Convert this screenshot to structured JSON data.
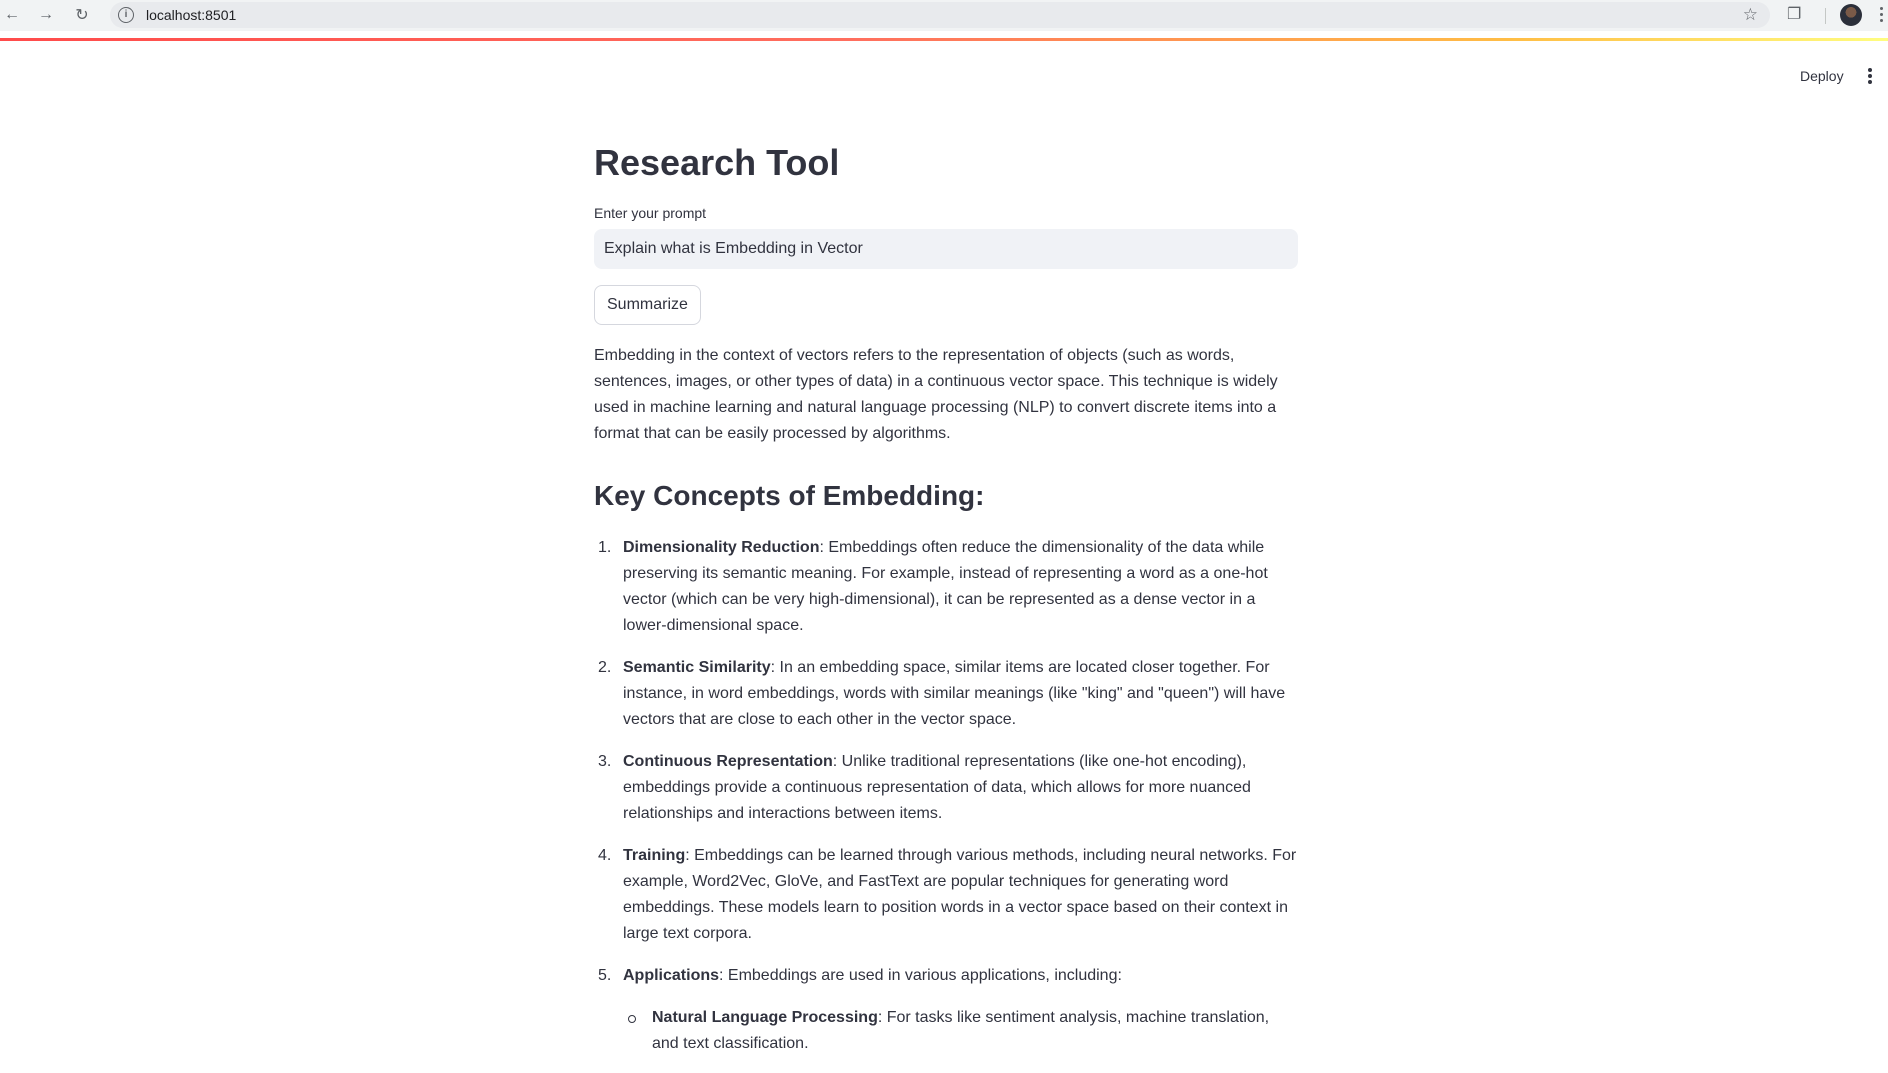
{
  "browser": {
    "url": "localhost:8501"
  },
  "header": {
    "deploy_label": "Deploy"
  },
  "main": {
    "title": "Research Tool",
    "prompt_label": "Enter your prompt",
    "prompt_value": "Explain what is Embedding in Vector",
    "summarize_label": "Summarize",
    "intro": "Embedding in the context of vectors refers to the representation of objects (such as words, sentences, images, or other types of data) in a continuous vector space. This technique is widely used in machine learning and natural language processing (NLP) to convert discrete items into a format that can be easily processed by algorithms.",
    "section_heading": "Key Concepts of Embedding:",
    "concepts": [
      {
        "num": "1.",
        "term": "Dimensionality Reduction",
        "text": ": Embeddings often reduce the dimensionality of the data while preserving its semantic meaning. For example, instead of representing a word as a one-hot vector (which can be very high-dimensional), it can be represented as a dense vector in a lower-dimensional space."
      },
      {
        "num": "2.",
        "term": "Semantic Similarity",
        "text": ": In an embedding space, similar items are located closer together. For instance, in word embeddings, words with similar meanings (like \"king\" and \"queen\") will have vectors that are close to each other in the vector space."
      },
      {
        "num": "3.",
        "term": "Continuous Representation",
        "text": ": Unlike traditional representations (like one-hot encoding), embeddings provide a continuous representation of data, which allows for more nuanced relationships and interactions between items."
      },
      {
        "num": "4.",
        "term": "Training",
        "text": ": Embeddings can be learned through various methods, including neural networks. For example, Word2Vec, GloVe, and FastText are popular techniques for generating word embeddings. These models learn to position words in a vector space based on their context in large text corpora."
      },
      {
        "num": "5.",
        "term": "Applications",
        "text": ": Embeddings are used in various applications, including:"
      }
    ],
    "applications": [
      {
        "term": "Natural Language Processing",
        "text": ": For tasks like sentiment analysis, machine translation, and text classification."
      }
    ]
  }
}
